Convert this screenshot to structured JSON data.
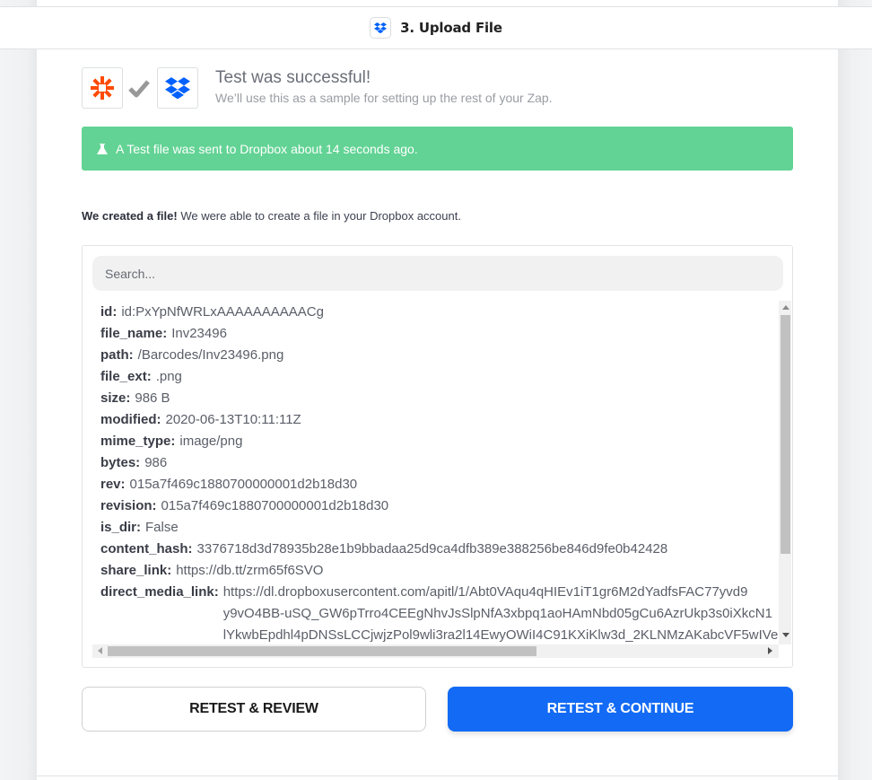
{
  "header": {
    "app_icon": "dropbox-icon",
    "title": "3. Upload File"
  },
  "test_result": {
    "source_icon": "zapier-icon",
    "status_icon": "check-icon",
    "target_icon": "dropbox-icon",
    "title": "Test was successful!",
    "subtitle": "We’ll use this as a sample for setting up the rest of your Zap."
  },
  "alert": {
    "icon": "flask-icon",
    "text": "A Test file was sent to Dropbox about 14 seconds ago.",
    "color": "#62d394"
  },
  "created": {
    "bold": "We created a file!",
    "text": " We were able to create a file in your Dropbox account."
  },
  "search": {
    "placeholder": "Search..."
  },
  "fields": [
    {
      "key": "id:",
      "value": "id:PxYpNfWRLxAAAAAAAAAACg"
    },
    {
      "key": "file_name:",
      "value": "Inv23496"
    },
    {
      "key": "path:",
      "value": "/Barcodes/Inv23496.png"
    },
    {
      "key": "file_ext:",
      "value": ".png"
    },
    {
      "key": "size:",
      "value": "986 B"
    },
    {
      "key": "modified:",
      "value": "2020-06-13T10:11:11Z"
    },
    {
      "key": "mime_type:",
      "value": "image/png"
    },
    {
      "key": "bytes:",
      "value": "986"
    },
    {
      "key": "rev:",
      "value": "015a7f469c1880700000001d2b18d30"
    },
    {
      "key": "revision:",
      "value": "015a7f469c1880700000001d2b18d30"
    },
    {
      "key": "is_dir:",
      "value": "False"
    },
    {
      "key": "content_hash:",
      "value": "3376718d3d78935b28e1b9bbadaa25d9ca4dfb389e388256be846d9fe0b42428"
    },
    {
      "key": "share_link:",
      "value": "https://db.tt/zrm65f6SVO"
    }
  ],
  "direct_media_link": {
    "key": "direct_media_link:",
    "lines": [
      "https://dl.dropboxusercontent.com/apitl/1/Abt0VAqu4qHIEv1iT1gr6M2dYadfsFAC77yvd9",
      "y9vO4BB-uSQ_GW6pTrro4CEEgNhvJsSlpNfA3xbpq1aoHAmNbd05gCu6AzrUkp3s0iXkcN1",
      "lYkwbEpdhl4pDNSsLCCjwjzPol9wli3ra2l14EwyOWiI4C91KXiKlw3d_2KLNMzAKabcVF5wIVe"
    ]
  },
  "buttons": {
    "review": "RETEST & REVIEW",
    "continue": "RETEST & CONTINUE",
    "continue_color": "#136bf5"
  }
}
